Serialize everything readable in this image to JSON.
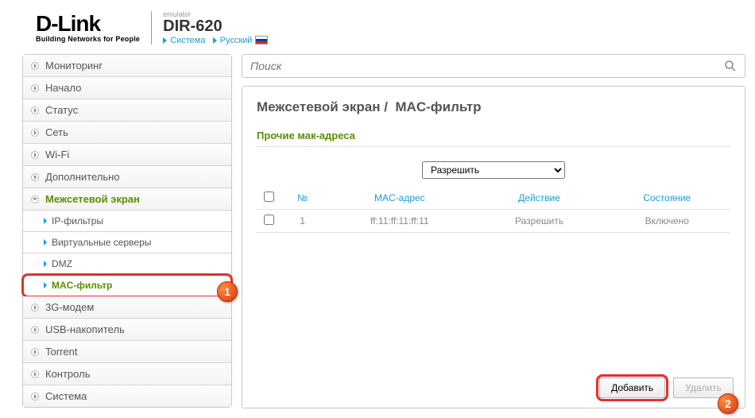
{
  "header": {
    "logo_text": "D-Link",
    "logo_sub": "Building Networks for People",
    "emulator_label": "emulator",
    "model": "DIR-620",
    "link_system": "Система",
    "link_lang": "Русский"
  },
  "sidebar": {
    "items": [
      "Мониторинг",
      "Начало",
      "Статус",
      "Сеть",
      "Wi-Fi",
      "Дополнительно",
      "Межсетевой экран",
      "3G-модем",
      "USB-накопитель",
      "Torrent",
      "Контроль",
      "Система"
    ],
    "firewall_sub": [
      "IP-фильтры",
      "Виртуальные серверы",
      "DMZ",
      "MAC-фильтр"
    ]
  },
  "content": {
    "search_placeholder": "Поиск",
    "breadcrumb_1": "Межсетевой экран",
    "breadcrumb_sep": " / ",
    "breadcrumb_2": "MAC-фильтр",
    "section_title": "Прочие мак-адреса",
    "select_value": "Разрешить",
    "columns": {
      "num": "№",
      "mac": "MAC-адрес",
      "action": "Действие",
      "state": "Состояние"
    },
    "rows": [
      {
        "num": "1",
        "mac": "ff:11:ff:11:ff:11",
        "action": "Разрешить",
        "state": "Включено"
      }
    ],
    "btn_add": "Добавить",
    "btn_delete": "Удалить"
  },
  "badges": {
    "one": "1",
    "two": "2"
  }
}
